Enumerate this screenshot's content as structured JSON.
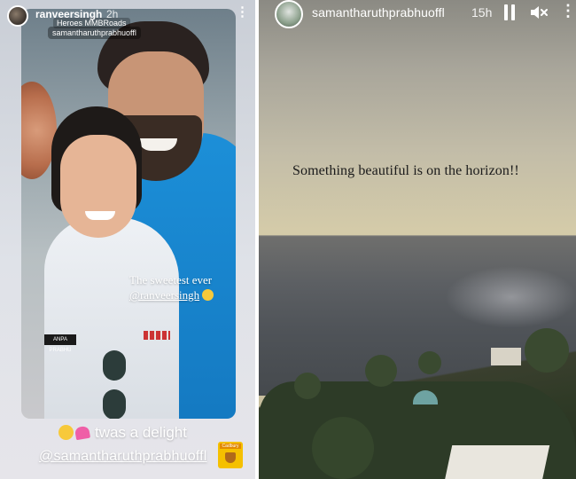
{
  "left_story": {
    "username": "ranveersingh",
    "time": "2h",
    "tag_top": "samantharuthprabhuoffl",
    "tag_sub": "Heroes MMBRoads",
    "caption_line1": "The sweetest ever",
    "caption_mention": "@ranveersingh",
    "badge_text": "ANPA PRABHU",
    "bottom_text": "twas a delight",
    "bottom_mention": "@samantharuthprabhuoffl",
    "sticker_text": "Cadbury"
  },
  "right_story": {
    "username": "samantharuthprabhuoffl",
    "time": "15h",
    "caption": "Something beautiful is on the horizon!!"
  },
  "icons": {
    "more": "⋮",
    "pause": "pause-icon",
    "mute": "speaker-muted-icon",
    "emoji_hug": "hugging-face-emoji",
    "emoji_hearts": "two-hearts-emoji",
    "emoji_smile": "smiling-face-emoji"
  },
  "colors": {
    "shirt_blue": "#1c8fd8",
    "caption_dark": "#1b1b1b"
  }
}
